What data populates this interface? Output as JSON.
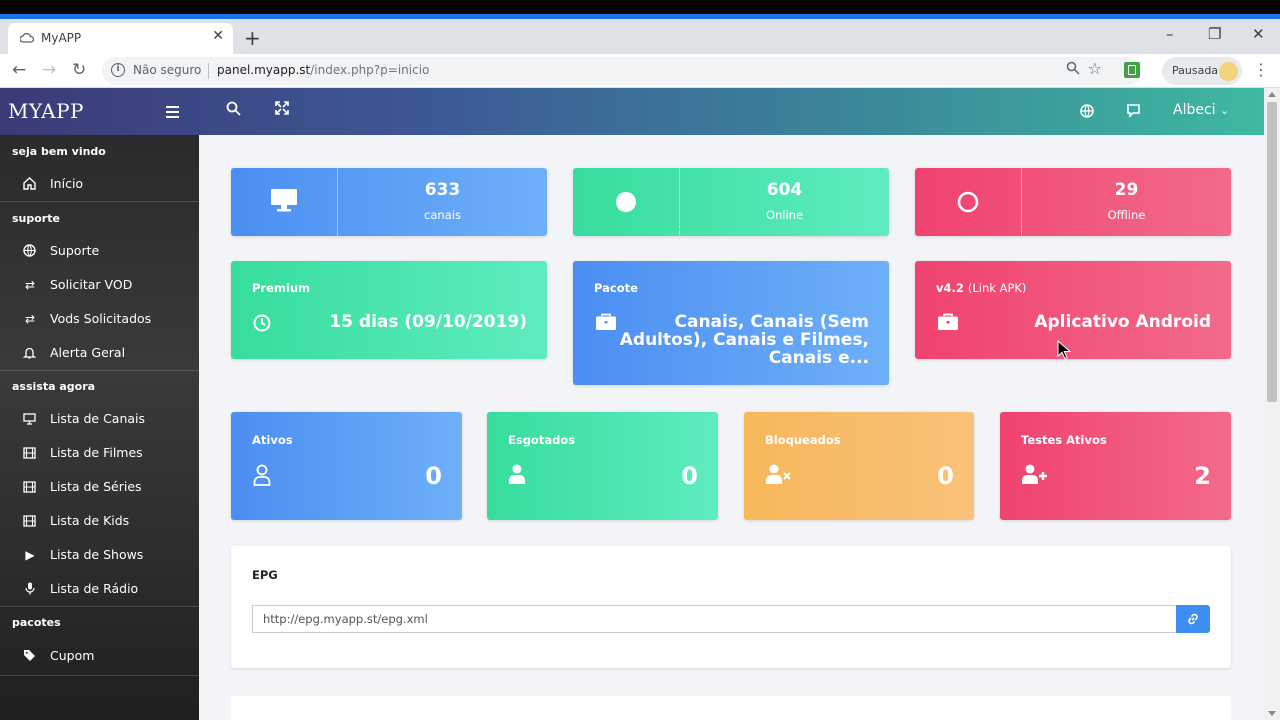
{
  "browser": {
    "tab_title": "MyAPP",
    "tab_close": "✕",
    "new_tab": "+",
    "url_security": "Não seguro",
    "url_host": "panel.myapp.st",
    "url_path": "/index.php?p=inicio",
    "profile_label": "Pausada",
    "window_controls": [
      "–",
      "❐",
      "✕"
    ],
    "accent": "#1a73e8"
  },
  "app": {
    "brand": "MYAPP",
    "user": "Albeci"
  },
  "sidebar": {
    "sections": [
      {
        "label": "seja bem vindo",
        "items": [
          {
            "label": "Início",
            "icon": "home-icon"
          }
        ]
      },
      {
        "label": "suporte",
        "items": [
          {
            "label": "Suporte",
            "icon": "globe-icon"
          },
          {
            "label": "Solicitar VOD",
            "icon": "exchange-icon"
          },
          {
            "label": "Vods Solicitados",
            "icon": "exchange-icon"
          },
          {
            "label": "Alerta Geral",
            "icon": "bell-icon"
          }
        ]
      },
      {
        "label": "assista agora",
        "items": [
          {
            "label": "Lista de Canais",
            "icon": "monitor-icon"
          },
          {
            "label": "Lista de Filmes",
            "icon": "film-icon"
          },
          {
            "label": "Lista de Séries",
            "icon": "film-icon"
          },
          {
            "label": "Lista de Kids",
            "icon": "film-icon"
          },
          {
            "label": "Lista de Shows",
            "icon": "play-icon"
          },
          {
            "label": "Lista de Rádio",
            "icon": "microphone-icon"
          }
        ]
      },
      {
        "label": "pacotes",
        "items": [
          {
            "label": "Cupom",
            "icon": "tag-icon"
          }
        ]
      }
    ]
  },
  "stats": [
    {
      "value": "633",
      "label": "canais",
      "color": "blue",
      "icon": "monitor-icon"
    },
    {
      "value": "604",
      "label": "Online",
      "color": "green",
      "icon": "circle-filled-icon"
    },
    {
      "value": "29",
      "label": "Offline",
      "color": "red",
      "icon": "circle-outline-icon"
    }
  ],
  "info": {
    "premium": {
      "title": "Premium",
      "value": "15 dias (09/10/2019)"
    },
    "pacote": {
      "title": "Pacote",
      "value_lines": [
        "Canais, Canais (Sem",
        "Adultos), Canais e Filmes,",
        "Canais e..."
      ]
    },
    "apk": {
      "version": "v4.2",
      "link": "(Link APK)",
      "value": "Aplicativo Android"
    }
  },
  "counters": [
    {
      "title": "Ativos",
      "value": "0",
      "color": "blue",
      "icon": "user-outline-icon"
    },
    {
      "title": "Esgotados",
      "value": "0",
      "color": "green",
      "icon": "user-icon"
    },
    {
      "title": "Bloqueados",
      "value": "0",
      "color": "orange",
      "icon": "user-times-icon"
    },
    {
      "title": "Testes Ativos",
      "value": "2",
      "color": "red",
      "icon": "user-plus-icon"
    }
  ],
  "epg": {
    "title": "EPG",
    "url": "http://epg.myapp.st/epg.xml"
  }
}
